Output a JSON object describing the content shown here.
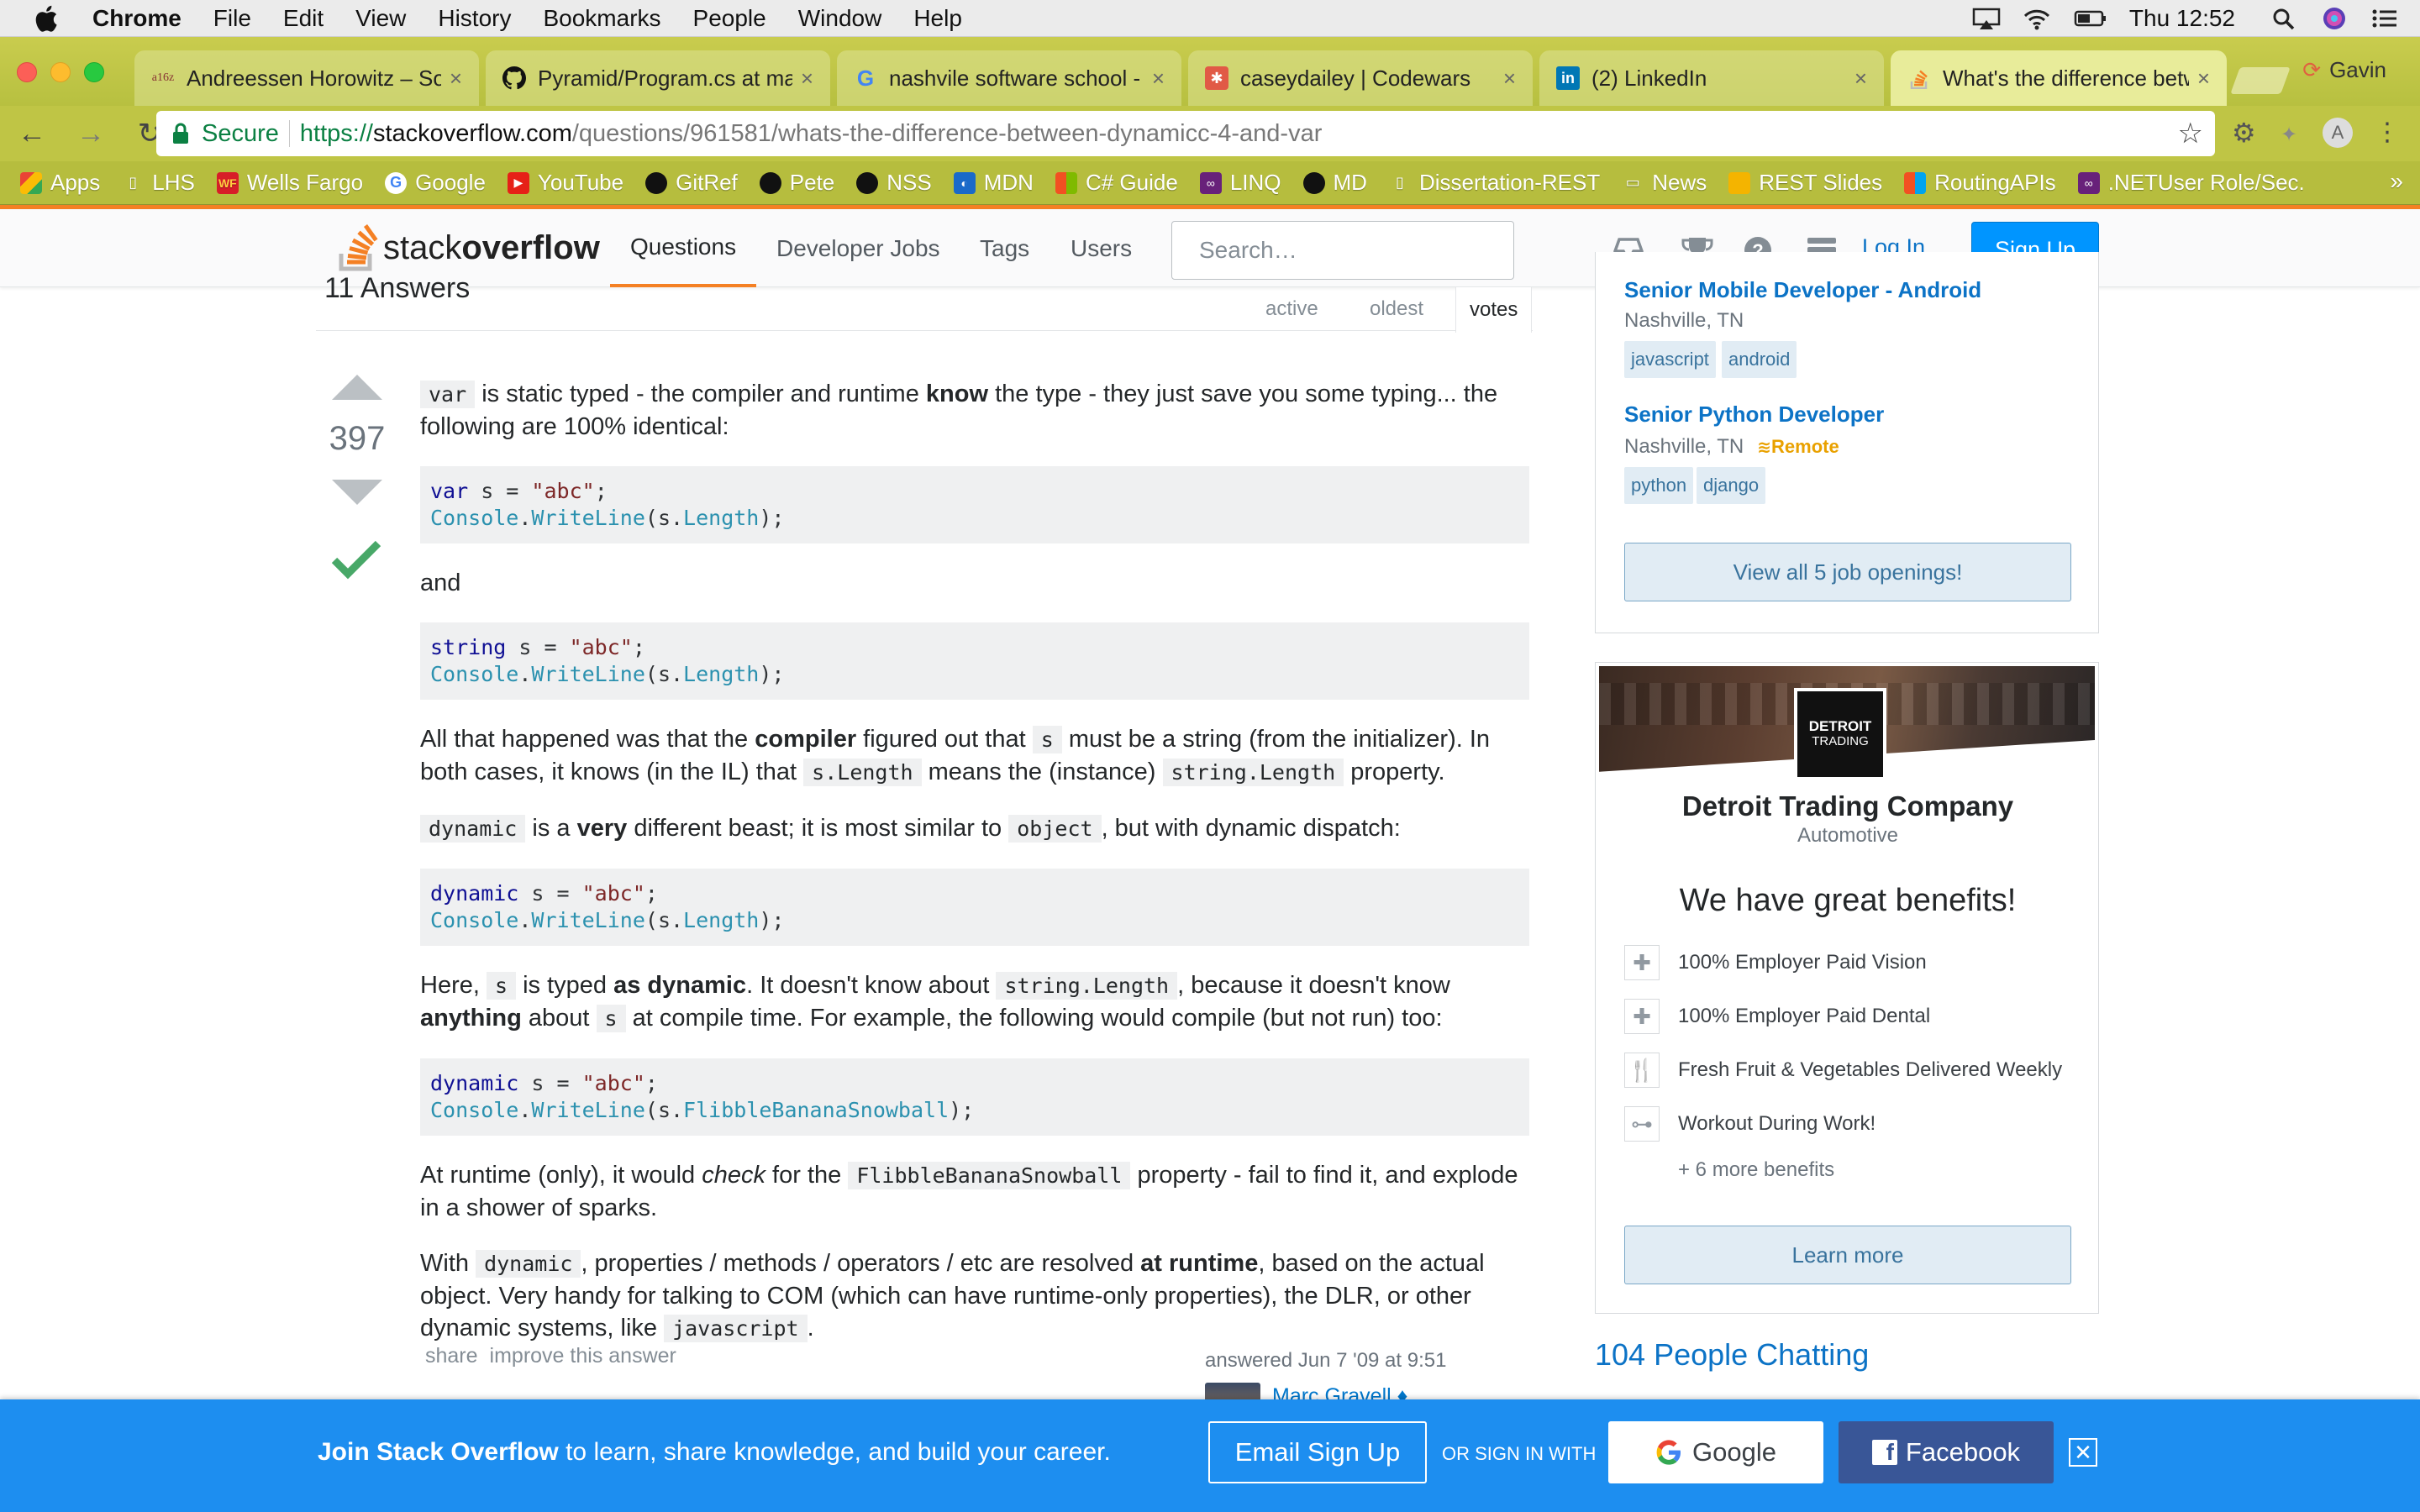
{
  "menubar": {
    "app": "Chrome",
    "items": [
      "File",
      "Edit",
      "View",
      "History",
      "Bookmarks",
      "People",
      "Window",
      "Help"
    ],
    "clock": "Thu 12:52"
  },
  "tabs": [
    {
      "label": "Andreessen Horowitz – Sof",
      "favicon": "a16z"
    },
    {
      "label": "Pyramid/Program.cs at ma",
      "favicon": "github-icon"
    },
    {
      "label": "nashvile software school - ",
      "favicon": "google-icon"
    },
    {
      "label": "caseydailey | Codewars",
      "favicon": "codewars-icon"
    },
    {
      "label": "(2) LinkedIn",
      "favicon": "linkedin-icon"
    },
    {
      "label": "What's the difference betw",
      "favicon": "stackoverflow-icon"
    }
  ],
  "profile": "Gavin",
  "omnibox": {
    "secure_label": "Secure",
    "scheme": "https://",
    "host": "stackoverflow.com",
    "path": "/questions/961581/whats-the-difference-between-dynamicc-4-and-var"
  },
  "bookmarks": [
    "Apps",
    "LHS",
    "Wells Fargo",
    "Google",
    "YouTube",
    "GitRef",
    "Pete",
    "NSS",
    "MDN",
    "C# Guide",
    "LINQ",
    "MD",
    "Dissertation-REST",
    "News",
    "REST Slides",
    "RoutingAPIs",
    ".NETUser Role/Sec."
  ],
  "so_header": {
    "logo_light": "stack",
    "logo_bold": "overflow",
    "nav": [
      "Questions",
      "Developer Jobs",
      "Tags",
      "Users"
    ],
    "search_placeholder": "Search…",
    "login": "Log In",
    "signup": "Sign Up"
  },
  "answers": {
    "count_label": "11 Answers",
    "sort_tabs": [
      "active",
      "oldest",
      "votes"
    ]
  },
  "answer": {
    "votes": "397",
    "p1_code_var": "var",
    "p1_a": " is static typed - the compiler and runtime ",
    "p1_know": "know",
    "p1_b": " the type - they just save you some typing... the following are 100% identical:",
    "code1_kw": "var",
    "code1_rest": " s = ",
    "code1_str": "\"abc\"",
    "code1_end": ";",
    "console": "Console",
    "writeline": "WriteLine",
    "length": "Length",
    "and": "and",
    "code2_kw": "string",
    "p2_a": "All that happened was that the ",
    "p2_compiler": "compiler",
    "p2_b": " figured out that ",
    "p2_s": "s",
    "p2_c": " must be a string (from the initializer). In both cases, it knows (in the IL) that ",
    "p2_slen": "s.Length",
    "p2_d": " means the (instance) ",
    "p2_strlen": "string.Length",
    "p2_e": " property.",
    "p3_dynamic": "dynamic",
    "p3_a": " is a ",
    "p3_very": "very",
    "p3_b": " different beast; it is most similar to ",
    "p3_object": "object",
    "p3_c": ", but with dynamic dispatch:",
    "code3_kw": "dynamic",
    "p4_a": "Here, ",
    "p4_b": " is typed ",
    "p4_asdyn": "as dynamic",
    "p4_c": ". It doesn't know about ",
    "p4_d": ", because it doesn't know ",
    "p4_anything": "anything",
    "p4_e": " about ",
    "p4_f": " at compile time. For example, the following would compile (but not run) too:",
    "flibble": "FlibbleBananaSnowball",
    "p5_a": "At runtime (only), it would ",
    "p5_check": "check",
    "p5_b": " for the ",
    "p5_c": " property - fail to find it, and explode in a shower of sparks.",
    "p6_a": "With ",
    "p6_b": ", properties / methods / operators / etc are resolved ",
    "p6_runtime": "at runtime",
    "p6_c": ", based on the actual object. Very handy for talking to COM (which can have runtime-only properties), the DLR, or other dynamic systems, like ",
    "p6_js": "javascript",
    "p6_d": ".",
    "share": "share",
    "improve": "improve this answer",
    "answered": "answered Jun 7 '09 at 9:51",
    "user": "Marc Gravell ♦"
  },
  "jobs": [
    {
      "title": "Senior Mobile Developer - Android",
      "location": "Nashville, TN",
      "remote": "",
      "tags": [
        "javascript",
        "android"
      ]
    },
    {
      "title": "Senior Python Developer",
      "location": "Nashville, TN",
      "remote": "Remote",
      "tags": [
        "python",
        "django"
      ]
    }
  ],
  "jobs_button": "View all 5 job openings!",
  "ad": {
    "logo_line1": "DETROIT",
    "logo_line2": "TRADING",
    "company": "Detroit Trading Company",
    "industry": "Automotive",
    "headline": "We have great benefits!",
    "benefits": [
      {
        "label": "100% Employer Paid Vision",
        "icon": "plus-icon"
      },
      {
        "label": "100% Employer Paid Dental",
        "icon": "plus-icon"
      },
      {
        "label": "Fresh Fruit & Vegetables Delivered Weekly",
        "icon": "utensils-icon"
      },
      {
        "label": "Workout During Work!",
        "icon": "dumbbell-icon"
      }
    ],
    "more": "+ 6 more benefits",
    "button": "Learn more"
  },
  "chatting": "104 People Chatting",
  "joinbar": {
    "bold": "Join Stack Overflow",
    "rest": " to learn, share knowledge, and build your career.",
    "email": "Email Sign Up",
    "or": "OR SIGN IN WITH",
    "google": "Google",
    "facebook": "Facebook",
    "close": "✕"
  },
  "colors": {
    "so_orange": "#f48024",
    "so_blue": "#0095ff",
    "chrome_theme": "#bfc545",
    "join_bar": "#1d8ef0",
    "facebook": "#395697"
  }
}
